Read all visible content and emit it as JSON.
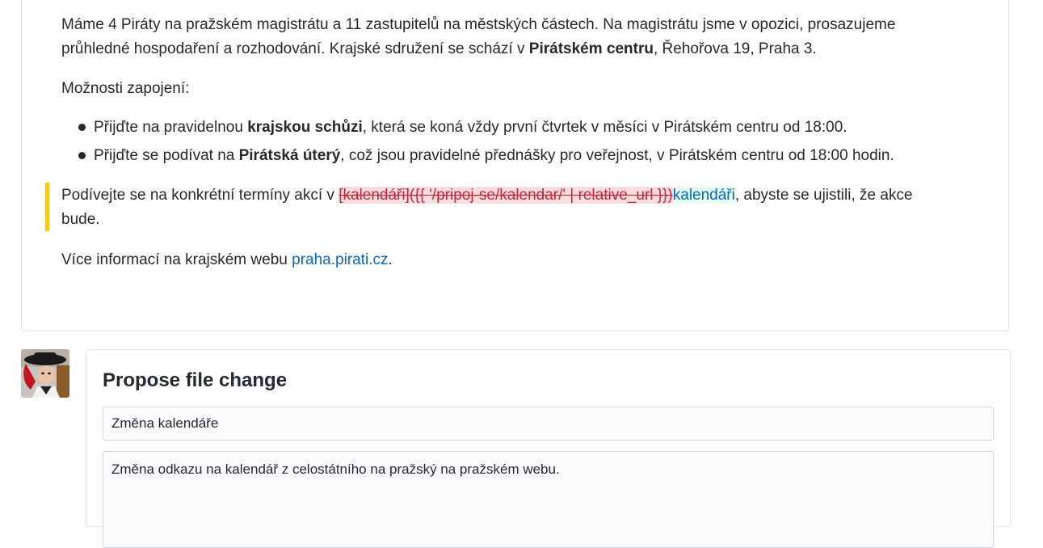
{
  "diff": {
    "p1_text": "Máme 4 Piráty na pražském magistrátu a 11 zastupitelů na městských částech. Na magistrátu jsme v opozici, prosazujeme průhledné hospodaření a rozhodování. Krajské sdružení se schází v ",
    "p1_bold": "Pirátském centru",
    "p1_tail": ", Řehořova 19, Praha 3.",
    "p2_text": "Možnosti zapojení:",
    "list": [
      {
        "pre": "Přijďte na pravidelnou ",
        "bold": "krajskou schůzi",
        "post": ", která se koná vždy první čtvrtek v měsíci v Pirátském centru od 18:00."
      },
      {
        "pre": "Přijďte se podívat na ",
        "bold": "Pirátská úterý",
        "post": ", což jsou pravidelné přednášky pro veřejnost, v Pirátském centru od 18:00 hodin."
      }
    ],
    "p3_pre": "Podívejte se na konkrétní termíny akcí v ",
    "p3_deleted": "[kalendáři]({{ '/pripoj-se/kalendar/' | relative_url }})",
    "p3_inserted": "kalendáři",
    "p3_post": ", abyste se ujistili, že akce bude.",
    "p4_pre": "Více informací na krajském webu ",
    "p4_link": "praha.pirati.cz",
    "p4_post": "."
  },
  "propose": {
    "title": "Propose file change",
    "commit_title_value": "Změna kalendáře",
    "commit_description_value": "Změna odkazu na kalendář z celostátního na pražský na pražském webu."
  },
  "colors": {
    "deleted_bg": "#ffdce0",
    "deleted_fg": "#cb2431",
    "inserted_bg": "#e6ffed",
    "link": "#0366d6",
    "changed_marker": "#f5c518"
  }
}
